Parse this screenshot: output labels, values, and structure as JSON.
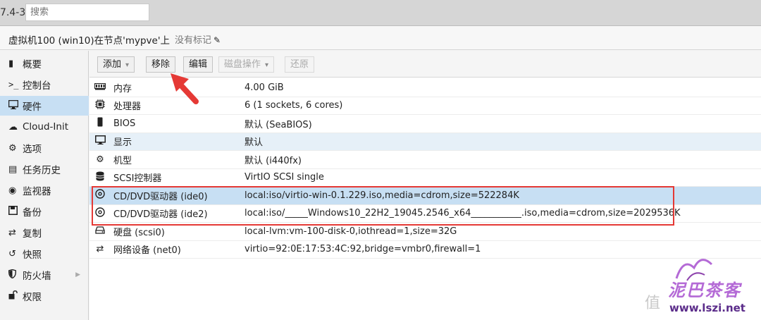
{
  "topbar": {
    "version": "7.4-3",
    "search_placeholder": "搜索"
  },
  "header": {
    "title": "虚拟机100 (win10)在节点'mypve'上",
    "tags": "没有标记"
  },
  "sidebar": {
    "items": [
      {
        "label": "概要",
        "icon": "book-icon"
      },
      {
        "label": "控制台",
        "icon": "terminal-icon"
      },
      {
        "label": "硬件",
        "icon": "monitor-icon"
      },
      {
        "label": "Cloud-Init",
        "icon": "cloud-icon"
      },
      {
        "label": "选项",
        "icon": "gear-icon"
      },
      {
        "label": "任务历史",
        "icon": "list-icon"
      },
      {
        "label": "监视器",
        "icon": "eye-icon"
      },
      {
        "label": "备份",
        "icon": "floppy-icon"
      },
      {
        "label": "复制",
        "icon": "retweet-icon"
      },
      {
        "label": "快照",
        "icon": "history-icon"
      },
      {
        "label": "防火墙",
        "icon": "shield-icon"
      },
      {
        "label": "权限",
        "icon": "unlock-icon"
      }
    ]
  },
  "toolbar": {
    "add": "添加",
    "remove": "移除",
    "edit": "编辑",
    "disk_action": "磁盘操作",
    "revert": "还原"
  },
  "hardware": [
    {
      "name": "内存",
      "value": "4.00 GiB",
      "icon": "memory-icon"
    },
    {
      "name": "处理器",
      "value": "6 (1 sockets, 6 cores)",
      "icon": "cpu-icon"
    },
    {
      "name": "BIOS",
      "value": "默认 (SeaBIOS)",
      "icon": "chip-icon"
    },
    {
      "name": "显示",
      "value": "默认",
      "icon": "display-icon"
    },
    {
      "name": "机型",
      "value": "默认 (i440fx)",
      "icon": "cogs-icon"
    },
    {
      "name": "SCSI控制器",
      "value": "VirtIO SCSI single",
      "icon": "database-icon"
    },
    {
      "name": "CD/DVD驱动器 (ide0)",
      "value": "local:iso/virtio-win-0.1.229.iso,media=cdrom,size=522284K",
      "icon": "disc-icon"
    },
    {
      "name": "CD/DVD驱动器 (ide2)",
      "value": "local:iso/_____Windows10_22H2_19045.2546_x64___________.iso,media=cdrom,size=2029536K",
      "icon": "disc-icon"
    },
    {
      "name": "硬盘 (scsi0)",
      "value": "local-lvm:vm-100-disk-0,iothread=1,size=32G",
      "icon": "hdd-icon"
    },
    {
      "name": "网络设备 (net0)",
      "value": "virtio=92:0E:17:53:4C:92,bridge=vmbr0,firewall=1",
      "icon": "exchange-icon"
    }
  ],
  "watermark": {
    "zhi": "值",
    "logo": "泥巴茶客",
    "url": "www.lszi.net"
  }
}
